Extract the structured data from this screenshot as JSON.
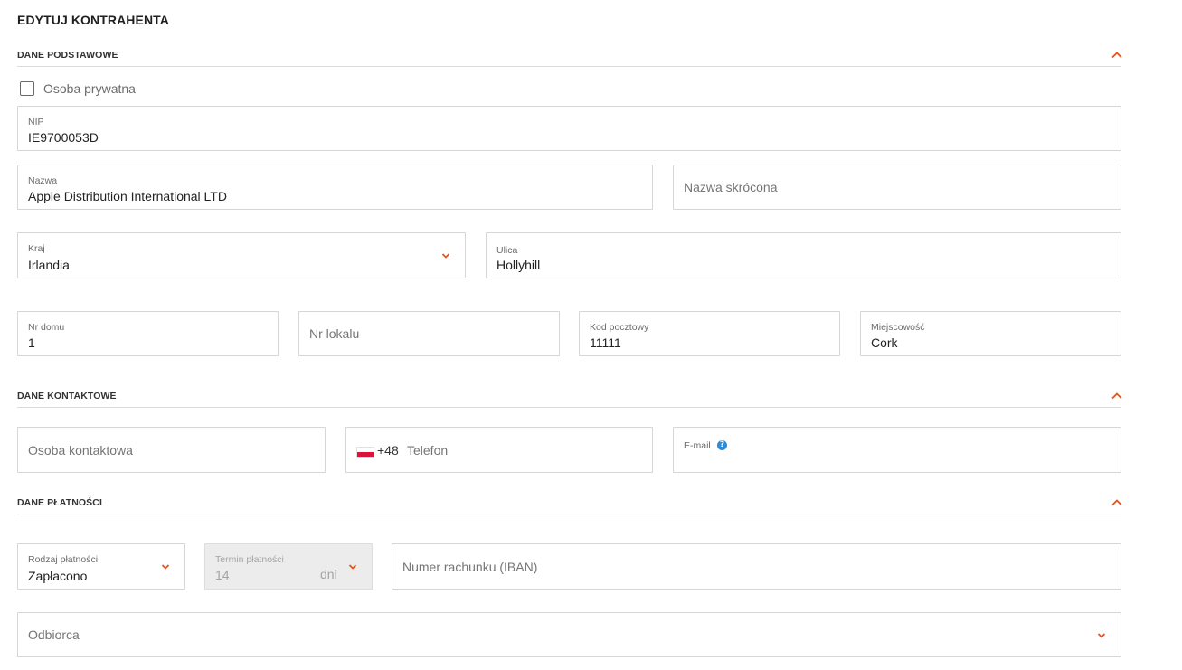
{
  "page": {
    "title": "EDYTUJ KONTRAHENTA"
  },
  "colors": {
    "accent": "#e8541e",
    "help": "#2a8bd8",
    "border": "#d6d6d6"
  },
  "sections": {
    "basic": {
      "title": "DANE PODSTAWOWE",
      "icon": "chevron-up-icon"
    },
    "contact": {
      "title": "DANE KONTAKTOWE",
      "icon": "chevron-up-icon"
    },
    "payment": {
      "title": "DANE PŁATNOŚCI",
      "icon": "chevron-up-icon"
    }
  },
  "basic": {
    "private_person": {
      "label": "Osoba prywatna",
      "checked": false
    },
    "nip": {
      "label": "NIP",
      "value": "IE9700053D"
    },
    "name": {
      "label": "Nazwa",
      "value": "Apple Distribution International LTD"
    },
    "short_name": {
      "placeholder": "Nazwa skrócona"
    },
    "country": {
      "label": "Kraj",
      "value": "Irlandia"
    },
    "street": {
      "label": "Ulica",
      "value": "Hollyhill"
    },
    "house_no": {
      "label": "Nr domu",
      "value": "1"
    },
    "unit_no": {
      "placeholder": "Nr lokalu"
    },
    "postal_code": {
      "label": "Kod pocztowy",
      "value": "11111"
    },
    "city": {
      "label": "Miejscowość",
      "value": "Cork"
    }
  },
  "contact": {
    "person": {
      "placeholder": "Osoba kontaktowa"
    },
    "phone": {
      "flag": "poland-flag-icon",
      "code": "+48",
      "placeholder": "Telefon"
    },
    "email": {
      "label": "E-mail",
      "help_icon": "?"
    }
  },
  "payment": {
    "type": {
      "label": "Rodzaj płatności",
      "value": "Zapłacono"
    },
    "term": {
      "label": "Termin płatności",
      "value": "14",
      "unit": "dni"
    },
    "iban": {
      "placeholder": "Numer rachunku (IBAN)"
    },
    "recipient": {
      "placeholder": "Odbiorca"
    }
  }
}
